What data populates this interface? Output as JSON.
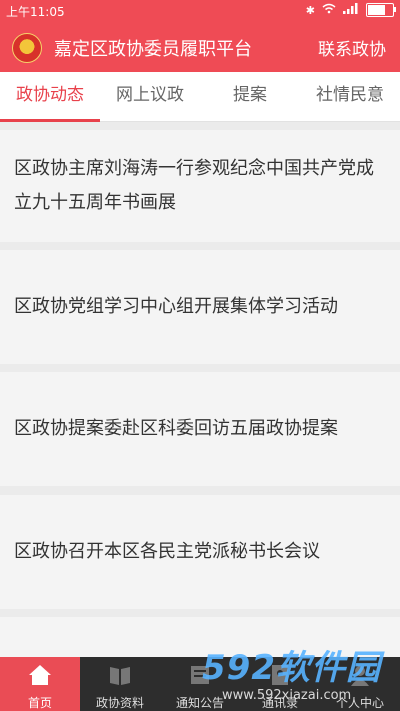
{
  "status_bar": {
    "time": "上午11:05",
    "battery_percent": 70
  },
  "header": {
    "title": "嘉定区政协委员履职平台",
    "contact_label": "联系政协"
  },
  "tabs": [
    {
      "label": "政协动态",
      "active": true
    },
    {
      "label": "网上议政",
      "active": false
    },
    {
      "label": "提案",
      "active": false
    },
    {
      "label": "社情民意",
      "active": false
    }
  ],
  "news": [
    {
      "title": "区政协主席刘海涛一行参观纪念中国共产党成立九十五周年书画展"
    },
    {
      "title": "区政协党组学习中心组开展集体学习活动"
    },
    {
      "title": "区政协提案委赴区科委回访五届政协提案"
    },
    {
      "title": "区政协召开本区各民主党派秘书长会议"
    },
    {
      "title": ""
    }
  ],
  "bottom_nav": [
    {
      "label": "首页",
      "icon": "home-icon",
      "active": true
    },
    {
      "label": "政协资料",
      "icon": "book-icon",
      "active": false
    },
    {
      "label": "通知公告",
      "icon": "notice-icon",
      "active": false
    },
    {
      "label": "通讯录",
      "icon": "contacts-icon",
      "active": false
    },
    {
      "label": "个人中心",
      "icon": "person-icon",
      "active": false
    }
  ],
  "watermark": {
    "brand": "592软件园",
    "url": "www.592xiazai.com"
  },
  "colors": {
    "brand_red": "#ef4b55",
    "tab_active": "#e8414b",
    "tabbar_bg": "#2d2d2d"
  }
}
